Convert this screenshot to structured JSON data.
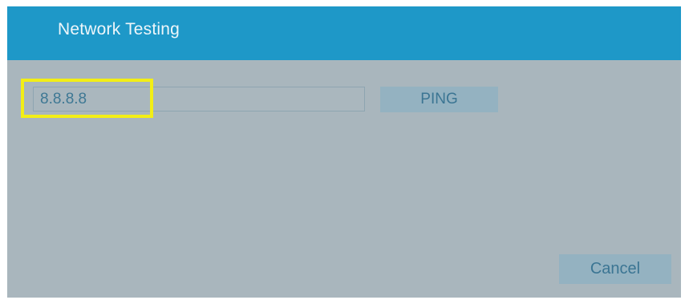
{
  "window": {
    "title": "Network Testing"
  },
  "ping_form": {
    "address_value": "8.8.8.8",
    "ping_label": "PING"
  },
  "footer": {
    "cancel_label": "Cancel"
  },
  "colors": {
    "title_bar": "#1e98c8",
    "dialog_background": "#a9b6bd",
    "button_background": "#94b2c1",
    "button_text": "#3b7593",
    "highlight": "#f2ee16"
  }
}
